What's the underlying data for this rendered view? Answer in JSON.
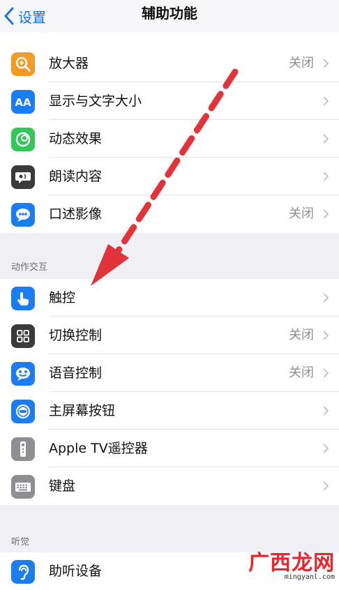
{
  "navbar": {
    "back_label": "设置",
    "title": "辅助功能"
  },
  "vision": {
    "items": [
      {
        "name": "magnifier",
        "label": "放大器",
        "value": "关闭",
        "icon": "magnifier-icon",
        "color": "#f59a23"
      },
      {
        "name": "display-text-size",
        "label": "显示与文字大小",
        "value": "",
        "icon": "aa-text-icon",
        "color": "#1c7cf2"
      },
      {
        "name": "motion",
        "label": "动态效果",
        "value": "",
        "icon": "motion-icon",
        "color": "#35c65a"
      },
      {
        "name": "spoken-content",
        "label": "朗读内容",
        "value": "",
        "icon": "speech-bubble-icon",
        "color": "#3a3a3c"
      },
      {
        "name": "audio-descriptions",
        "label": "口述影像",
        "value": "关闭",
        "icon": "quote-bubble-icon",
        "color": "#1c7cf2"
      }
    ]
  },
  "physical": {
    "header": "动作交互",
    "items": [
      {
        "name": "touch",
        "label": "触控",
        "value": "",
        "icon": "hand-pointer-icon",
        "color": "#1c7cf2"
      },
      {
        "name": "switch-control",
        "label": "切换控制",
        "value": "关闭",
        "icon": "grid-icon",
        "color": "#3a3a3c"
      },
      {
        "name": "voice-control",
        "label": "语音控制",
        "value": "关闭",
        "icon": "voice-control-icon",
        "color": "#1c7cf2"
      },
      {
        "name": "home-button",
        "label": "主屏幕按钮",
        "value": "",
        "icon": "home-button-icon",
        "color": "#1c7cf2"
      },
      {
        "name": "apple-tv-remote",
        "label": "Apple TV遥控器",
        "value": "",
        "icon": "remote-icon",
        "color": "#8e8e93"
      },
      {
        "name": "keyboards",
        "label": "键盘",
        "value": "",
        "icon": "keyboard-icon",
        "color": "#8e8e93"
      }
    ]
  },
  "hearing": {
    "header": "听觉",
    "items": [
      {
        "name": "hearing-devices",
        "label": "助听设备",
        "value": "",
        "icon": "ear-icon",
        "color": "#1c7cf2"
      }
    ]
  },
  "annotation": {
    "color": "#e0343a"
  },
  "watermark": {
    "text": "广西龙网",
    "url": "mingyanl.com"
  }
}
